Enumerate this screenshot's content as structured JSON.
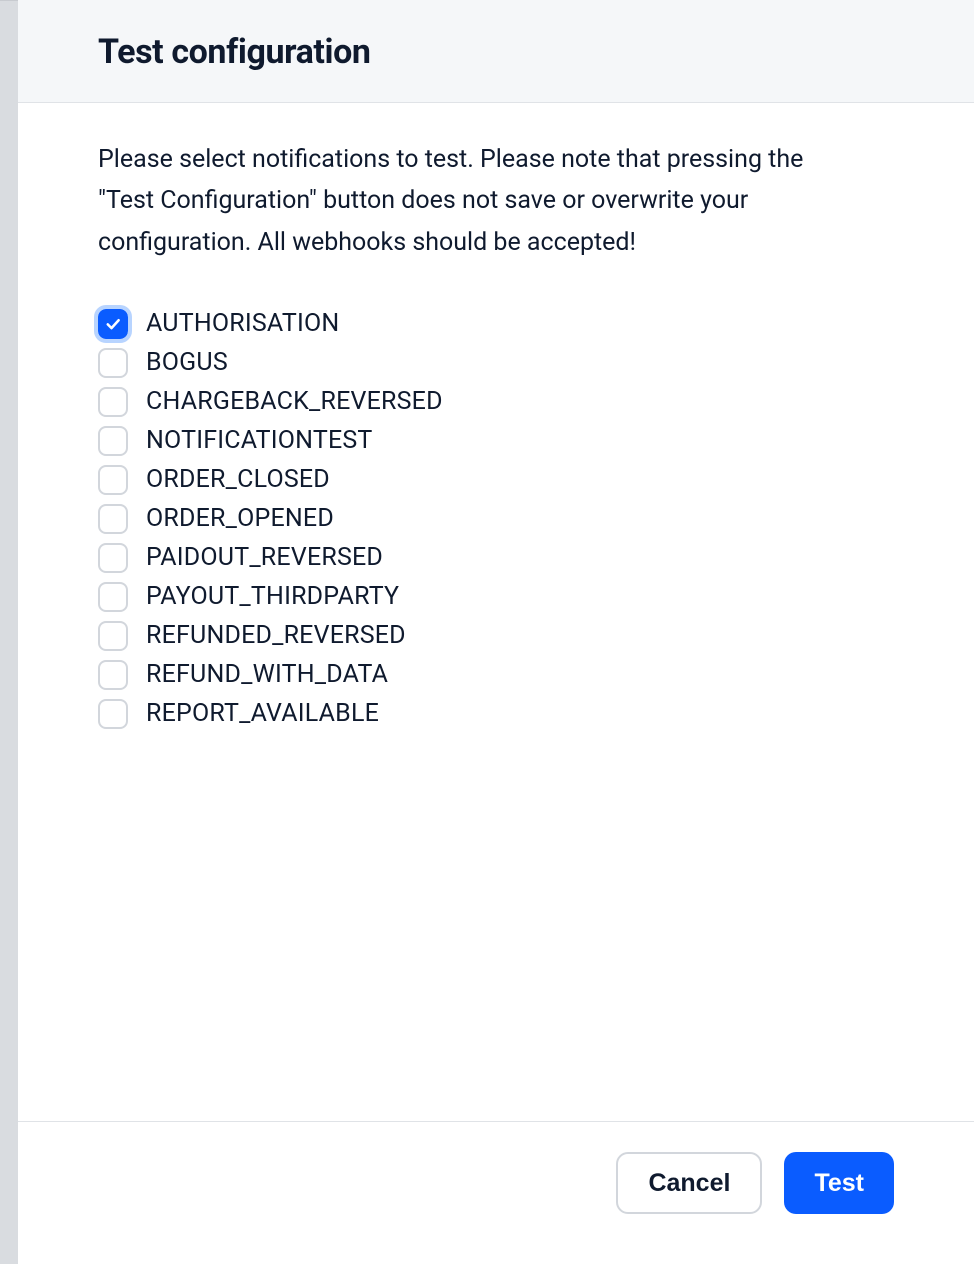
{
  "modal": {
    "title": "Test configuration",
    "instructions": "Please select notifications to test. Please note that pressing the \"Test Configuration\" button does not save or overwrite your configuration. All webhooks should be accepted!",
    "notifications": [
      {
        "label": "AUTHORISATION",
        "checked": true,
        "focused": true
      },
      {
        "label": "BOGUS",
        "checked": false,
        "focused": false
      },
      {
        "label": "CHARGEBACK_REVERSED",
        "checked": false,
        "focused": false
      },
      {
        "label": "NOTIFICATIONTEST",
        "checked": false,
        "focused": false
      },
      {
        "label": "ORDER_CLOSED",
        "checked": false,
        "focused": false
      },
      {
        "label": "ORDER_OPENED",
        "checked": false,
        "focused": false
      },
      {
        "label": "PAIDOUT_REVERSED",
        "checked": false,
        "focused": false
      },
      {
        "label": "PAYOUT_THIRDPARTY",
        "checked": false,
        "focused": false
      },
      {
        "label": "REFUNDED_REVERSED",
        "checked": false,
        "focused": false
      },
      {
        "label": "REFUND_WITH_DATA",
        "checked": false,
        "focused": false
      },
      {
        "label": "REPORT_AVAILABLE",
        "checked": false,
        "focused": false
      }
    ],
    "buttons": {
      "cancel": "Cancel",
      "test": "Test"
    }
  }
}
